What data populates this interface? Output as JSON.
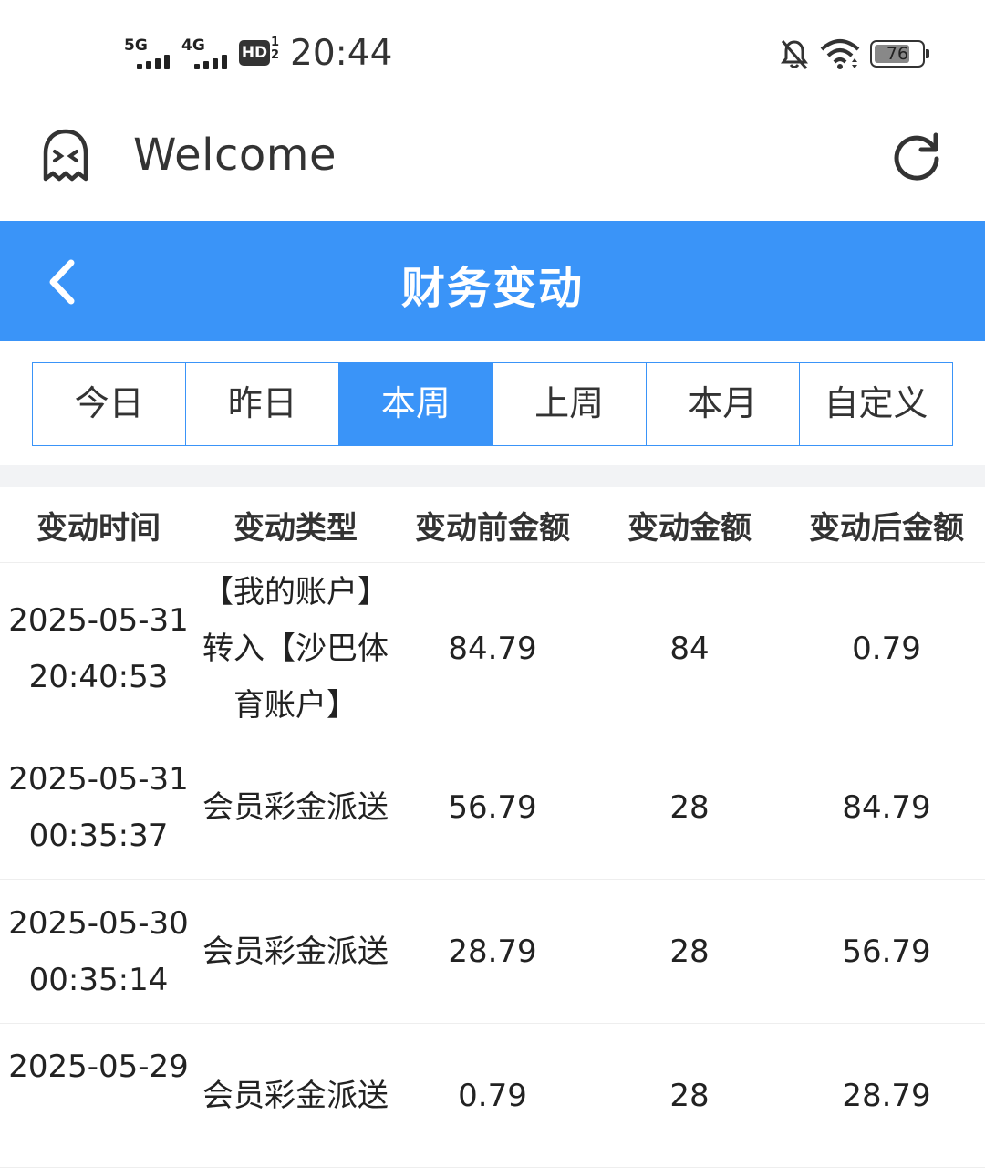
{
  "status_bar": {
    "signal1_label": "5G",
    "signal2_label": "4G",
    "hd_label": "HD",
    "hd_sub": "1\n2",
    "time": "20:44",
    "battery": "76",
    "battery_level": 0.76
  },
  "app_bar": {
    "title": "Welcome",
    "icons": [
      "ghost-icon",
      "refresh-icon"
    ]
  },
  "header": {
    "title": "财务变动",
    "back_icon": "chevron-left-icon",
    "color": "#3a94f8"
  },
  "tabs": [
    {
      "label": "今日",
      "active": false
    },
    {
      "label": "昨日",
      "active": false
    },
    {
      "label": "本周",
      "active": true
    },
    {
      "label": "上周",
      "active": false
    },
    {
      "label": "本月",
      "active": false
    },
    {
      "label": "自定义",
      "active": false
    }
  ],
  "table": {
    "columns": [
      "变动时间",
      "变动类型",
      "变动前金额",
      "变动金额",
      "变动后金额"
    ],
    "rows": [
      {
        "date": "2025-05-31",
        "time": "20:40:53",
        "type": "【我的账户】转入【沙巴体育账户】",
        "before": "84.79",
        "amount": "84",
        "after": "0.79"
      },
      {
        "date": "2025-05-31",
        "time": "00:35:37",
        "type": "会员彩金派送",
        "before": "56.79",
        "amount": "28",
        "after": "84.79"
      },
      {
        "date": "2025-05-30",
        "time": "00:35:14",
        "type": "会员彩金派送",
        "before": "28.79",
        "amount": "28",
        "after": "56.79"
      },
      {
        "date": "2025-05-29",
        "time": "",
        "type": "会员彩金派送",
        "before": "0.79",
        "amount": "28",
        "after": "28.79"
      }
    ]
  }
}
